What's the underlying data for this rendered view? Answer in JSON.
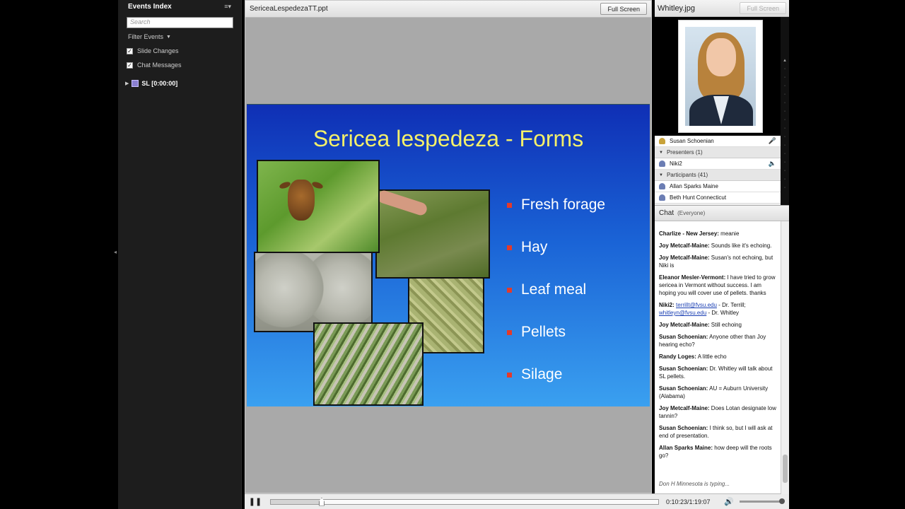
{
  "events_panel": {
    "title": "Events Index",
    "search_placeholder": "Search",
    "filter_label": "Filter Events",
    "filters": [
      "Slide Changes",
      "Chat Messages"
    ],
    "tree_item": "SL [0:00:00]"
  },
  "slide_pane": {
    "file_name": "SericeaLespedezaTT.ppt",
    "full_screen_label": "Full Screen",
    "slide": {
      "title": "Sericea lespedeza - Forms",
      "bullets": [
        "Fresh forage",
        "Hay",
        "Leaf meal",
        "Pellets",
        "Silage"
      ]
    }
  },
  "playback": {
    "time": "0:10:23/1:19:07",
    "progress": 0.1313,
    "volume": 1.0
  },
  "photo_pane": {
    "file_name": "Whitley.jpg",
    "full_screen_label": "Full Screen"
  },
  "attendees": {
    "host": "Susan Schoenian",
    "presenters_label": "Presenters (1)",
    "presenter": "Niki2",
    "participants_label": "Participants (41)",
    "participants": [
      "Allan Sparks Maine",
      "Beth Hunt Connecticut"
    ]
  },
  "chat": {
    "title": "Chat",
    "scope": "(Everyone)",
    "messages": [
      {
        "who": "Charlize -    New Jersey:",
        "text": " meanie"
      },
      {
        "who": "Joy Metcalf-Maine:",
        "text": " Sounds like it's echoing."
      },
      {
        "who": "Joy Metcalf-Maine:",
        "text": " Susan's not echoing, but Niki is"
      },
      {
        "who": "Eleanor Mesler-Vermont:",
        "text": " I have tried to grow sericea in Vermont without success.  I am hoping you will cover use of pellets. thanks"
      },
      {
        "who": "Niki2:",
        "link1": "terrillt@fvsu.edu",
        "mid": " - Dr. Terrill; ",
        "link2": "whitleyn@fvsu.edu",
        "text": " - Dr. Whitley"
      },
      {
        "who": "Joy Metcalf-Maine:",
        "text": " Still echoing"
      },
      {
        "who": "Susan Schoenian:",
        "text": " Anyone other than Joy hearing echo?"
      },
      {
        "who": "Randy Loges:",
        "text": " A little echo"
      },
      {
        "who": "Susan Schoenian:",
        "text": " Dr. Whitley will talk about SL pellets."
      },
      {
        "who": "Susan Schoenian:",
        "text": " AU = Auburn University (Alabama)"
      },
      {
        "who": "Joy Metcalf-Maine:",
        "text": " Does Lotan designate low tannin?"
      },
      {
        "who": "Susan Schoenian:",
        "text": " I think so, but I will ask at end of presentation."
      },
      {
        "who": "Allan Sparks Maine:",
        "text": " how deep will the roots go?"
      }
    ],
    "typing": "Don H  Minnesota is typing..."
  }
}
